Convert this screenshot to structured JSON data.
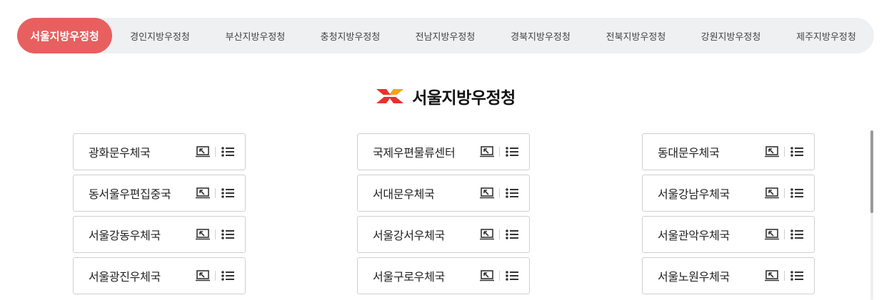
{
  "tabs": [
    {
      "label": "서울지방우정청",
      "active": true
    },
    {
      "label": "경인지방우정청",
      "active": false
    },
    {
      "label": "부산지방우정청",
      "active": false
    },
    {
      "label": "충청지방우정청",
      "active": false
    },
    {
      "label": "전남지방우정청",
      "active": false
    },
    {
      "label": "경북지방우정청",
      "active": false
    },
    {
      "label": "전북지방우정청",
      "active": false
    },
    {
      "label": "강원지방우정청",
      "active": false
    },
    {
      "label": "제주지방우정청",
      "active": false
    }
  ],
  "header": {
    "title": "서울지방우정청",
    "logo_colors": [
      "#e8322d",
      "#f2a51c"
    ]
  },
  "offices": [
    [
      "광화문우체국",
      "국제우편물류센터",
      "동대문우체국"
    ],
    [
      "동서울우편집중국",
      "서대문우체국",
      "서울강남우체국"
    ],
    [
      "서울강동우체국",
      "서울강서우체국",
      "서울관악우체국"
    ],
    [
      "서울광진우체국",
      "서울구로우체국",
      "서울노원우체국"
    ]
  ],
  "card_actions": [
    "map-icon",
    "list-icon"
  ],
  "colors": {
    "accent": "#e85f5f",
    "tabbar_bg": "#eef0f2"
  }
}
